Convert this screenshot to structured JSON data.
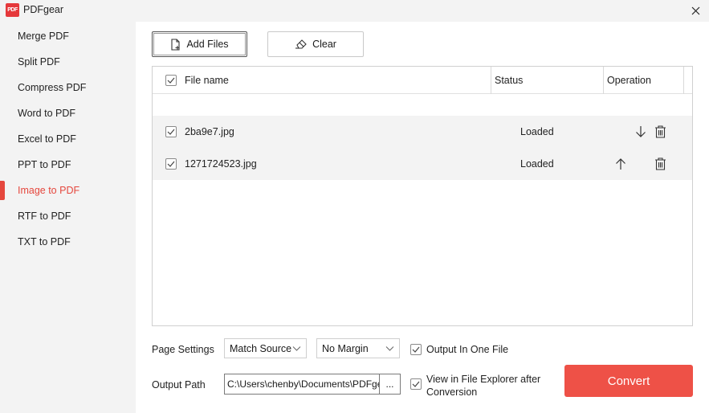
{
  "app": {
    "title": "PDFgear",
    "logo_text": "PDF"
  },
  "sidebar": {
    "items": [
      {
        "label": "Merge PDF"
      },
      {
        "label": "Split PDF"
      },
      {
        "label": "Compress PDF"
      },
      {
        "label": "Word to PDF"
      },
      {
        "label": "Excel to PDF"
      },
      {
        "label": "PPT to PDF"
      },
      {
        "label": "Image to PDF",
        "active": true
      },
      {
        "label": "RTF to PDF"
      },
      {
        "label": "TXT to PDF"
      }
    ]
  },
  "toolbar": {
    "add_files_label": "Add Files",
    "clear_label": "Clear"
  },
  "table": {
    "headers": {
      "file_name": "File name",
      "status": "Status",
      "operation": "Operation"
    },
    "rows": [
      {
        "file_name": "2ba9e7.jpg",
        "status": "Loaded",
        "checked": true,
        "move": "down"
      },
      {
        "file_name": "1271724523.jpg",
        "status": "Loaded",
        "checked": true,
        "move": "up"
      }
    ]
  },
  "settings": {
    "page_settings_label": "Page Settings",
    "page_size_value": "Match Source",
    "margin_value": "No Margin",
    "output_one_file_label": "Output In One File",
    "output_one_file_checked": true,
    "output_path_label": "Output Path",
    "output_path_value": "C:\\Users\\chenby\\Documents\\PDFgear",
    "browse_label": "...",
    "view_in_explorer_label_line1": "View in File Explorer after",
    "view_in_explorer_label_line2": "Conversion",
    "view_in_explorer_checked": true
  },
  "convert_label": "Convert",
  "colors": {
    "accent": "#ee5147",
    "sidebar_bg": "#f3f3f3",
    "row_bg": "#f3f3f3"
  }
}
